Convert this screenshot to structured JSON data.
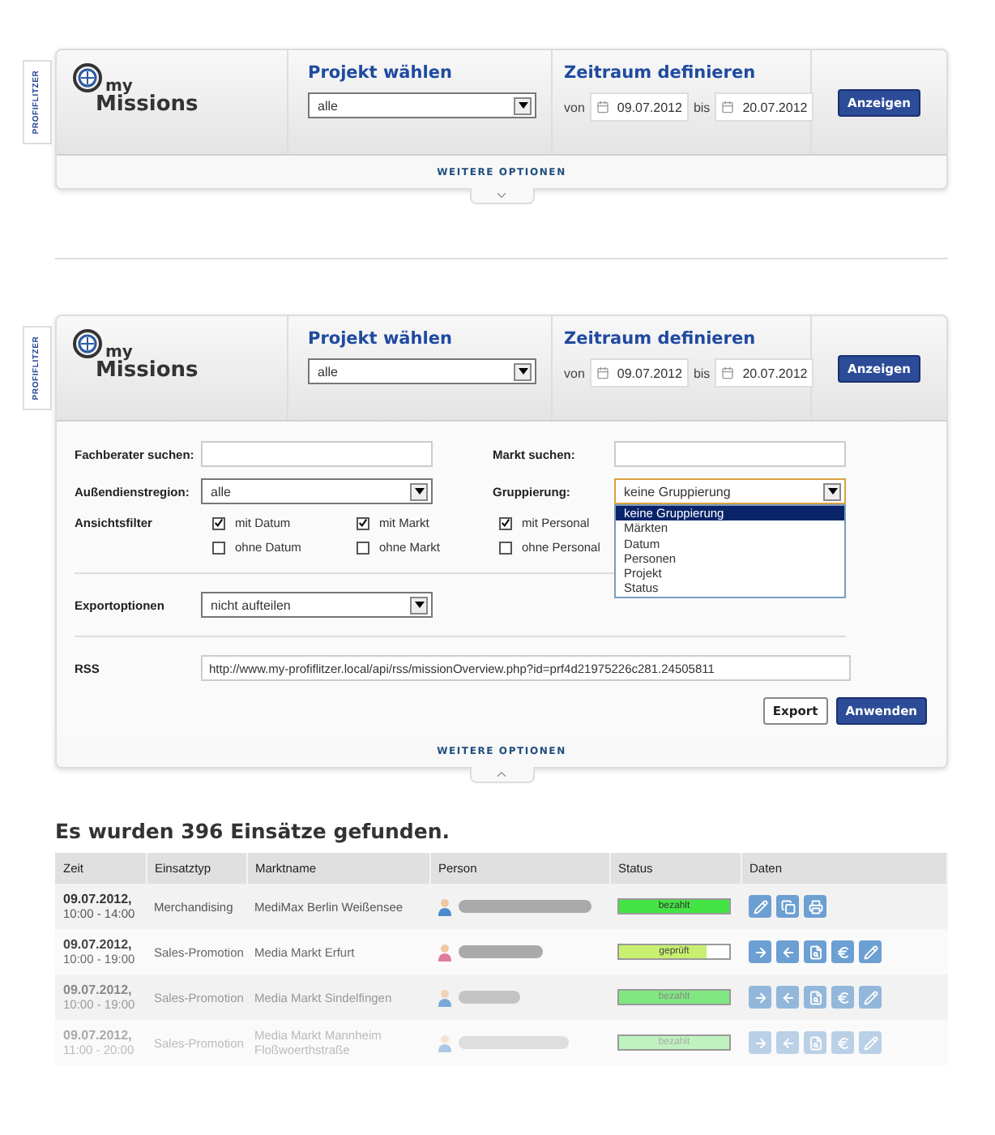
{
  "panels": [
    {
      "side_tab": "PROFIFLITZER",
      "logo_small": "my",
      "logo_big": "Missions",
      "project": {
        "heading": "Projekt wählen",
        "value": "alle"
      },
      "period": {
        "heading": "Zeitraum definieren",
        "from_label": "von",
        "from": "09.07.2012",
        "to_label": "bis",
        "to": "20.07.2012"
      },
      "show_button": "Anzeigen",
      "more_options": "WEITERE OPTIONEN",
      "expanded": false
    },
    {
      "side_tab": "PROFIFLITZER",
      "logo_small": "my",
      "logo_big": "Missions",
      "project": {
        "heading": "Projekt wählen",
        "value": "alle"
      },
      "period": {
        "heading": "Zeitraum definieren",
        "from_label": "von",
        "from": "09.07.2012",
        "to_label": "bis",
        "to": "20.07.2012"
      },
      "show_button": "Anzeigen",
      "more_options": "WEITERE OPTIONEN",
      "expanded": true,
      "options": {
        "search_fields": [
          {
            "label": "Fachberater suchen:"
          },
          {
            "label": "Markt suchen:"
          }
        ],
        "region": {
          "label": "Außendienstregion:",
          "value": "alle"
        },
        "grouping": {
          "label": "Gruppierung:",
          "value": "keine Gruppierung",
          "open": true,
          "choices": [
            {
              "label": "keine Gruppierung",
              "selected": true
            },
            {
              "label": "Märkten",
              "selected": false
            },
            {
              "label": "Datum",
              "selected": false
            },
            {
              "label": "Personen",
              "selected": false
            },
            {
              "label": "Projekt",
              "selected": false
            },
            {
              "label": "Status",
              "selected": false
            }
          ]
        },
        "view_filter": {
          "label": "Ansichtsfilter",
          "checks": [
            {
              "label": "mit Datum",
              "checked": true
            },
            {
              "label": "mit Markt",
              "checked": true
            },
            {
              "label": "mit Personal",
              "checked": true
            },
            {
              "label": "ohne Datum",
              "checked": false
            },
            {
              "label": "ohne Markt",
              "checked": false
            },
            {
              "label": "ohne Personal",
              "checked": false
            }
          ]
        },
        "export": {
          "label": "Exportoptionen",
          "value": "nicht aufteilen"
        },
        "rss": {
          "label": "RSS",
          "value": "http://www.my-profiflitzer.local/api/rss/missionOverview.php?id=prf4d21975226c281.24505811"
        },
        "buttons": [
          {
            "label": "Export",
            "kind": "secondary"
          },
          {
            "label": "Anwenden",
            "kind": "primary"
          }
        ]
      }
    }
  ],
  "results": {
    "heading": "Es wurden 396 Einsätze gefunden.",
    "columns": [
      "Zeit",
      "Einsatztyp",
      "Marktname",
      "Person",
      "Status",
      "Daten"
    ],
    "rows": [
      {
        "date": "09.07.2012,",
        "time": "10:00 - 14:00",
        "type": "Merchandising",
        "market": "MediMax Berlin Weißensee",
        "person": {
          "kind": "male"
        },
        "status": {
          "label": "bezahlt",
          "level": 1,
          "color": "#44e444"
        },
        "actions": [
          {
            "kind": "edit"
          },
          {
            "kind": "copy"
          },
          {
            "kind": "print"
          }
        ]
      },
      {
        "date": "09.07.2012,",
        "time": "10:00 - 19:00",
        "type": "Sales-Promotion",
        "market": "Media Markt Erfurt",
        "person": {
          "kind": "female"
        },
        "status": {
          "label": "geprüft",
          "level": 0.8,
          "color": "#c8f070"
        },
        "actions": [
          {
            "kind": "forward"
          },
          {
            "kind": "back"
          },
          {
            "kind": "inspect"
          },
          {
            "kind": "euro"
          },
          {
            "kind": "edit"
          }
        ]
      },
      {
        "date": "09.07.2012,",
        "time": "10:00 - 19:00",
        "type": "Sales-Promotion",
        "market": "Media Markt Sindelfingen",
        "person": {
          "kind": "male"
        },
        "status": {
          "label": "bezahlt",
          "level": 1,
          "color": "#80e880"
        },
        "actions": [
          {
            "kind": "forward"
          },
          {
            "kind": "back"
          },
          {
            "kind": "inspect"
          },
          {
            "kind": "euro"
          },
          {
            "kind": "edit"
          }
        ]
      },
      {
        "date": "09.07.2012,",
        "time": "11:00 - 20:00",
        "type": "Sales-Promotion",
        "market": "Media Markt Mannheim Floßwoerthstraße",
        "person": {
          "kind": "male"
        },
        "status": {
          "label": "bezahlt",
          "level": 1,
          "color": "#bff2bf"
        },
        "actions": [
          {
            "kind": "forward"
          },
          {
            "kind": "back"
          },
          {
            "kind": "inspect"
          },
          {
            "kind": "euro"
          },
          {
            "kind": "edit"
          }
        ]
      }
    ]
  }
}
